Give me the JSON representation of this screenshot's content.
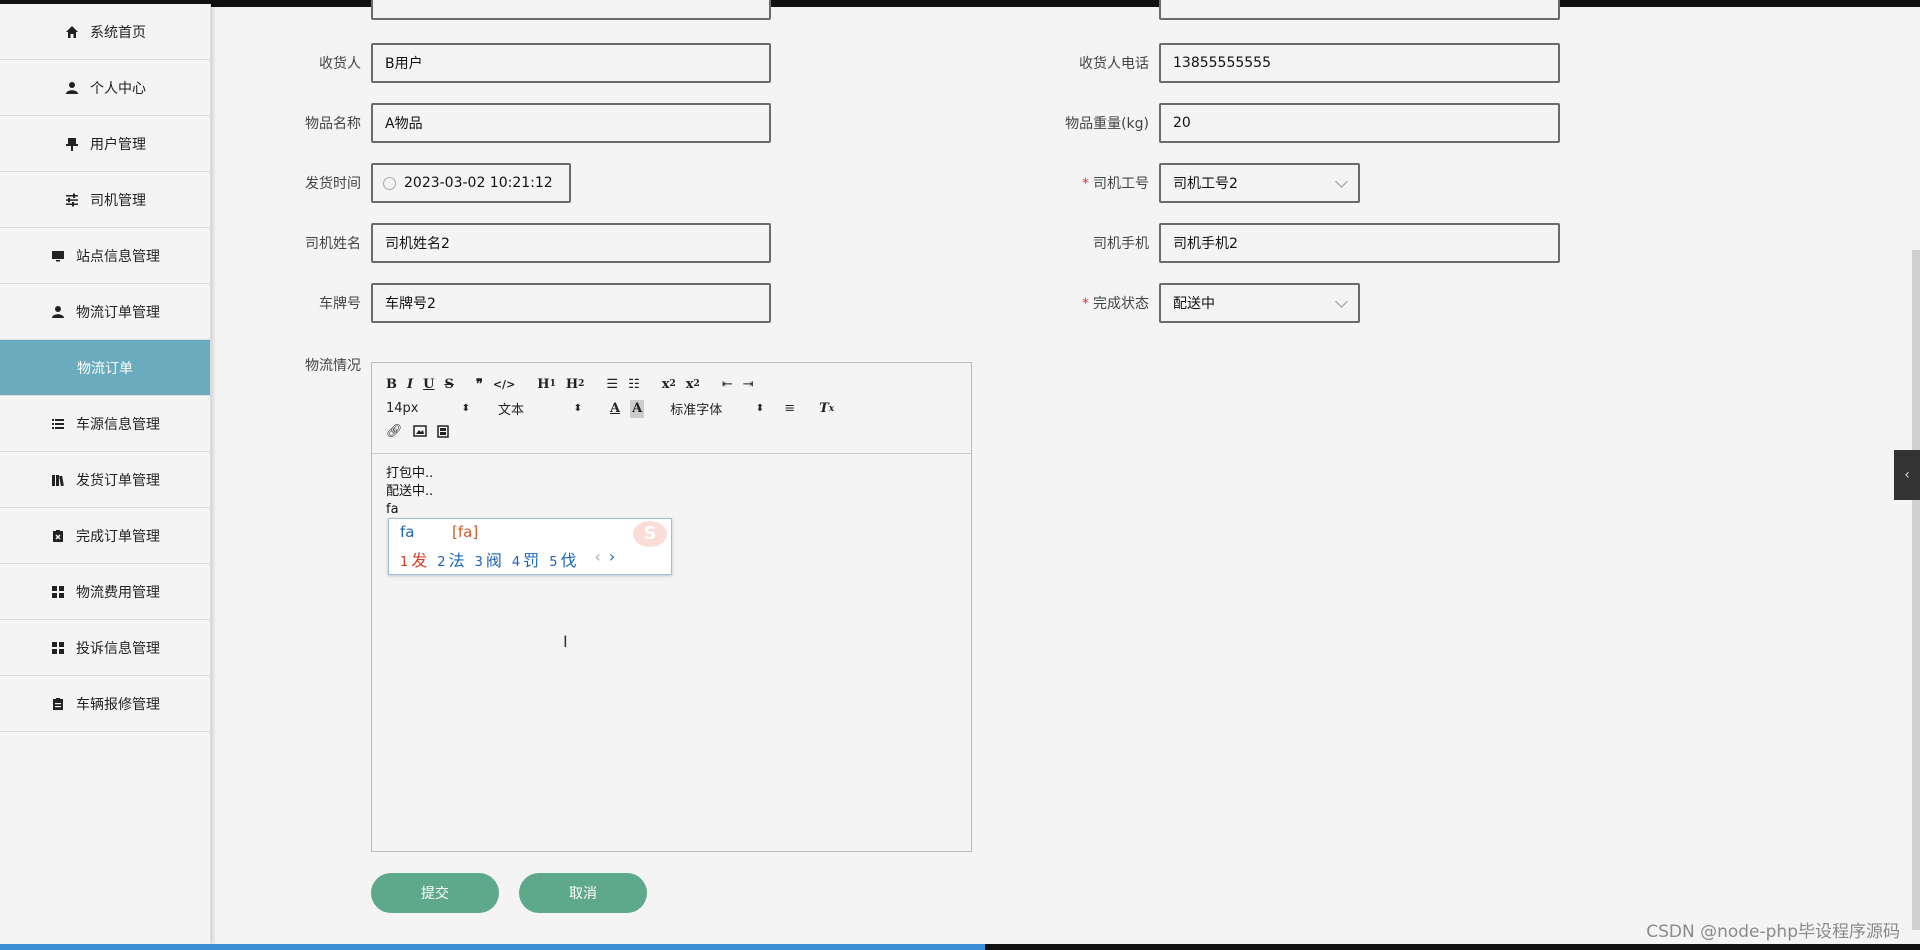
{
  "sidebar": {
    "items": [
      {
        "label": "系统首页",
        "icon": "home-icon"
      },
      {
        "label": "个人中心",
        "icon": "user-icon"
      },
      {
        "label": "用户管理",
        "icon": "pin-icon"
      },
      {
        "label": "司机管理",
        "icon": "sliders-icon"
      },
      {
        "label": "站点信息管理",
        "icon": "monitor-icon"
      },
      {
        "label": "物流订单管理",
        "icon": "user-icon"
      },
      {
        "label": "物流订单",
        "icon": ""
      },
      {
        "label": "车源信息管理",
        "icon": "list-icon"
      },
      {
        "label": "发货订单管理",
        "icon": "books-icon"
      },
      {
        "label": "完成订单管理",
        "icon": "clipboard-x-icon"
      },
      {
        "label": "物流费用管理",
        "icon": "grid-icon"
      },
      {
        "label": "投诉信息管理",
        "icon": "grid-icon"
      },
      {
        "label": "车辆报修管理",
        "icon": "clipboard-icon"
      }
    ],
    "active_index": 6
  },
  "form": {
    "consignee_label": "收货人",
    "consignee_value": "B用户",
    "consignee_phone_label": "收货人电话",
    "consignee_phone_value": "13855555555",
    "item_name_label": "物品名称",
    "item_name_value": "A物品",
    "item_weight_label": "物品重量(kg)",
    "item_weight_value": "20",
    "ship_time_label": "发货时间",
    "ship_time_value": "2023-03-02 10:21:12",
    "driver_id_label": "司机工号",
    "driver_id_value": "司机工号2",
    "driver_name_label": "司机姓名",
    "driver_name_value": "司机姓名2",
    "driver_phone_label": "司机手机",
    "driver_phone_value": "司机手机2",
    "plate_label": "车牌号",
    "plate_value": "车牌号2",
    "status_label": "完成状态",
    "status_value": "配送中",
    "logistics_label": "物流情况",
    "required_mark": "*"
  },
  "editor": {
    "font_size": "14px",
    "text_type": "文本",
    "font_family": "标准字体",
    "lines": [
      "打包中..",
      "配送中..",
      "fa"
    ]
  },
  "ime": {
    "input": "fa",
    "pinyin": "[fa]",
    "candidates": [
      {
        "n": "1",
        "text": "发"
      },
      {
        "n": "2",
        "text": "法"
      },
      {
        "n": "3",
        "text": "阀"
      },
      {
        "n": "4",
        "text": "罚"
      },
      {
        "n": "5",
        "text": "伐"
      }
    ],
    "prev": "‹",
    "next": "›"
  },
  "buttons": {
    "submit": "提交",
    "cancel": "取消"
  },
  "collapse_glyph": "‹",
  "watermark": "CSDN @node-php毕设程序源码",
  "colors": {
    "accent": "#6aacbd",
    "button": "#5ea88c",
    "required": "#e03b3b"
  }
}
